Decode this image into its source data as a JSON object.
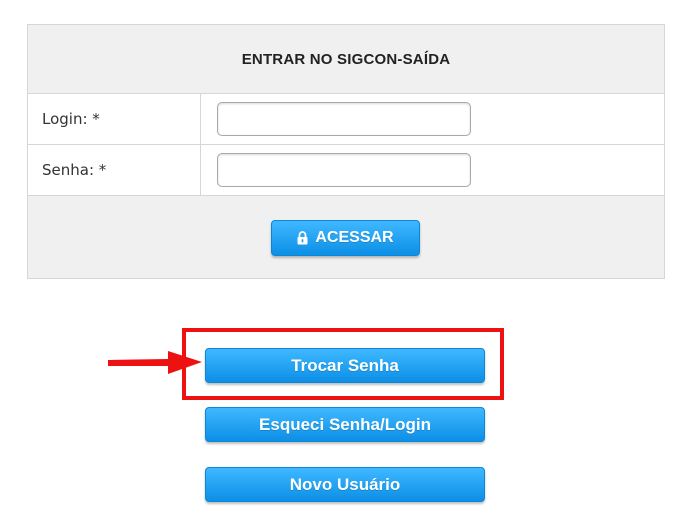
{
  "login_box": {
    "title": "ENTRAR NO SIGCON-SAÍDA",
    "fields": [
      {
        "label": "Login: *",
        "value": "",
        "placeholder": ""
      },
      {
        "label": "Senha: *",
        "value": "",
        "placeholder": ""
      }
    ],
    "submit": {
      "label": "ACESSAR",
      "icon": "lock-icon"
    }
  },
  "actions": {
    "change_password": "Trocar Senha",
    "forgot": "Esqueci Senha/Login",
    "new_user": "Novo Usuário"
  },
  "annotation": {
    "highlight_color": "#ee1111",
    "arrow_color": "#ee1111",
    "highlighted_item": "Trocar Senha"
  },
  "colors": {
    "button_blue": "#1fa3f5",
    "panel_gray": "#f0f0f0",
    "border_gray": "#d6d6d6"
  }
}
